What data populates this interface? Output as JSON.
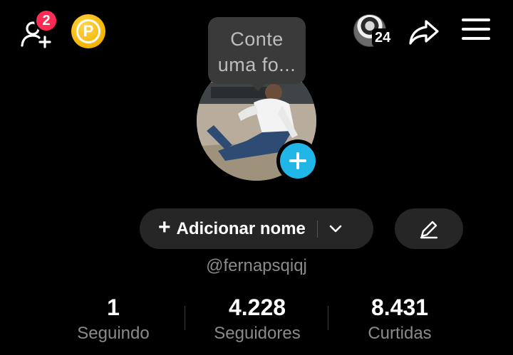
{
  "header": {
    "friend_requests_badge": "2",
    "coin_label": "P",
    "viewers_count": "24"
  },
  "tooltip": {
    "text": "Conte uma fo..."
  },
  "profile": {
    "add_name_plus": "+",
    "add_name_label": "Adicionar nome",
    "handle": "@fernapsqiqj"
  },
  "stats": [
    {
      "value": "1",
      "label": "Seguindo"
    },
    {
      "value": "4.228",
      "label": "Seguidores"
    },
    {
      "value": "8.431",
      "label": "Curtidas"
    }
  ],
  "colors": {
    "background": "#000000",
    "badge": "#fe2c55",
    "coin": "#f4b400",
    "avatar_add": "#20b7e8",
    "pill": "#262626",
    "secondary_text": "#8a8a8a"
  },
  "icons": [
    "add-friend-icon",
    "coin-icon",
    "viewer-avatar-icon",
    "share-icon",
    "menu-icon",
    "plus-icon",
    "chevron-down-icon",
    "pencil-icon"
  ]
}
